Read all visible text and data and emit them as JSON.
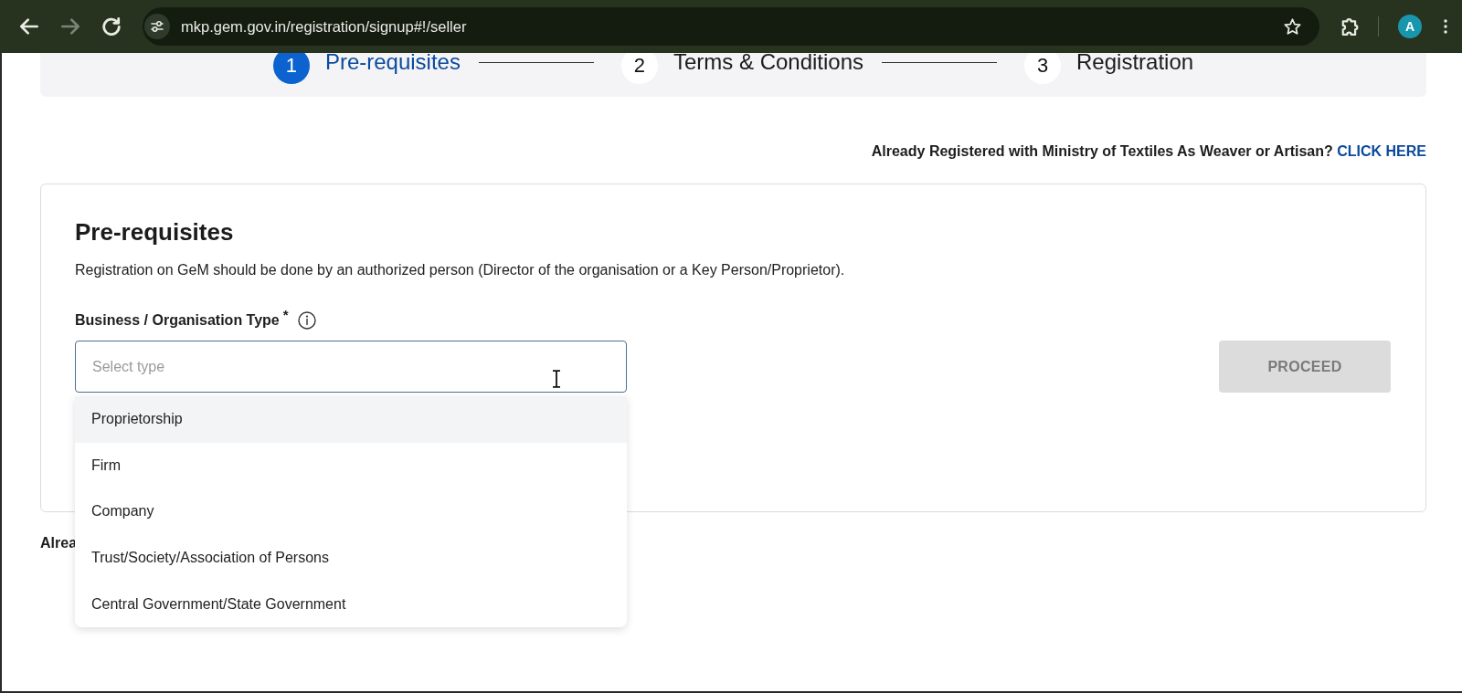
{
  "browser": {
    "back_button": {
      "disabled": false
    },
    "forward_button": {
      "disabled": true
    },
    "url": "mkp.gem.gov.in/registration/signup#!/seller",
    "profile_initial": "A"
  },
  "stepper": {
    "steps": [
      {
        "number": "1",
        "label": "Pre-requisites",
        "selected": true
      },
      {
        "number": "2",
        "label": "Terms & Conditions",
        "selected": false
      },
      {
        "number": "3",
        "label": "Registration",
        "selected": false
      }
    ]
  },
  "textiles_notice": {
    "text": "Already Registered with Ministry of Textiles As Weaver or Artisan?",
    "link": "CLICK HERE"
  },
  "prerequisites_card": {
    "title": "Pre-requisites",
    "description": "Registration on GeM should be done by an authorized person (Director of the organisation or a Key Person/Proprietor).",
    "business_type_field": {
      "label": "Business / Organisation Type",
      "required_mark": "*",
      "placeholder": "Select type",
      "expanded": true,
      "options": [
        {
          "label": "Proprietorship",
          "highlighted": true
        },
        {
          "label": "Firm",
          "highlighted": false
        },
        {
          "label": "Company",
          "highlighted": false
        },
        {
          "label": "Trust/Society/Association of Persons",
          "highlighted": false
        },
        {
          "label": "Central Government/State Government",
          "highlighted": false
        }
      ]
    },
    "proceed_button": {
      "label": "PROCEED",
      "disabled": true
    }
  },
  "partial_text": "Alrea"
}
